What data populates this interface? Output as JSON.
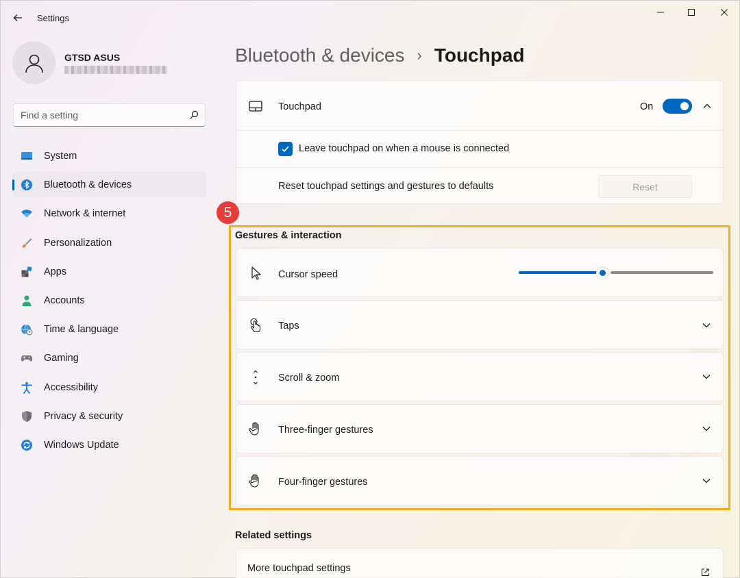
{
  "window": {
    "title": "Settings"
  },
  "profile": {
    "name": "GTSD ASUS"
  },
  "search": {
    "placeholder": "Find a setting"
  },
  "sidebar": {
    "items": [
      {
        "label": "System",
        "icon": "monitor-icon"
      },
      {
        "label": "Bluetooth & devices",
        "icon": "bluetooth-icon",
        "active": true
      },
      {
        "label": "Network & internet",
        "icon": "wifi-icon"
      },
      {
        "label": "Personalization",
        "icon": "brush-icon"
      },
      {
        "label": "Apps",
        "icon": "apps-icon"
      },
      {
        "label": "Accounts",
        "icon": "person-icon"
      },
      {
        "label": "Time & language",
        "icon": "globe-clock-icon"
      },
      {
        "label": "Gaming",
        "icon": "gamepad-icon"
      },
      {
        "label": "Accessibility",
        "icon": "accessibility-icon"
      },
      {
        "label": "Privacy & security",
        "icon": "shield-icon"
      },
      {
        "label": "Windows Update",
        "icon": "update-icon"
      }
    ]
  },
  "breadcrumb": {
    "parent": "Bluetooth & devices",
    "separator": "›",
    "current": "Touchpad"
  },
  "touchpad": {
    "label": "Touchpad",
    "toggle_state": "On",
    "toggle_on": true,
    "leave_on_label": "Leave touchpad on when a mouse is connected",
    "leave_on_checked": true,
    "reset_label": "Reset touchpad settings and gestures to defaults",
    "reset_button": "Reset"
  },
  "annotation": {
    "step": "5"
  },
  "gestures": {
    "title": "Gestures & interaction",
    "cursor_speed_label": "Cursor speed",
    "cursor_speed_value": 0.43,
    "items": [
      {
        "label": "Taps",
        "icon": "tap-icon"
      },
      {
        "label": "Scroll & zoom",
        "icon": "scroll-icon"
      },
      {
        "label": "Three-finger gestures",
        "icon": "hand-icon"
      },
      {
        "label": "Four-finger gestures",
        "icon": "hand-icon"
      }
    ]
  },
  "related": {
    "title": "Related settings",
    "more_touchpad": "More touchpad settings"
  },
  "colors": {
    "accent": "#0067c0",
    "highlight": "#f2ad1f",
    "badge": "#e63c3c"
  }
}
